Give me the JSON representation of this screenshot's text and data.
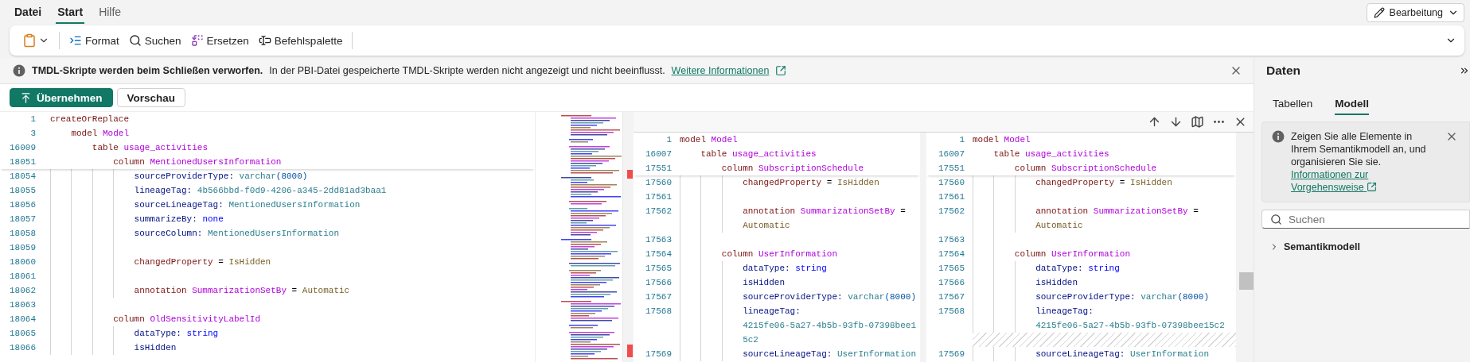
{
  "menu": {
    "tabs": [
      {
        "label": "Datei",
        "kind": "menu",
        "selected": false
      },
      {
        "label": "Start",
        "kind": "tab",
        "selected": true
      },
      {
        "label": "Hilfe",
        "kind": "tab",
        "selected": false
      }
    ],
    "mode_button": "Bearbeitung"
  },
  "toolbar": {
    "items": [
      {
        "kind": "paste"
      },
      {
        "kind": "format",
        "label": "Format"
      },
      {
        "kind": "search",
        "label": "Suchen"
      },
      {
        "kind": "replace",
        "label": "Ersetzen"
      },
      {
        "kind": "palette",
        "label": "Befehlspalette"
      }
    ]
  },
  "infobar": {
    "title": "TMDL-Skripte werden beim Schließen verworfen.",
    "message": "In der PBI-Datei gespeicherte TMDL-Skripte werden nicht angezeigt und nicht beeinflusst.",
    "link": "Weitere Informationen"
  },
  "actions": [
    {
      "label": "Übernehmen",
      "kind": "primary"
    },
    {
      "label": "Vorschau",
      "kind": "secondary"
    }
  ],
  "editor": {
    "lines": [
      {
        "number": "1",
        "sticky": true,
        "tokens": [
          {
            "kind": "keyword",
            "text": "createOrReplace"
          }
        ],
        "children": [
          {
            "number": "3",
            "sticky": true,
            "tokens": [
              {
                "kind": "keyword",
                "text": "model"
              },
              {
                "kind": "name",
                "text": "Model"
              }
            ],
            "children": [
              {
                "number": "16009",
                "sticky": true,
                "tokens": [
                  {
                    "kind": "keyword",
                    "text": "table"
                  },
                  {
                    "kind": "name",
                    "text": "usage_activities"
                  }
                ],
                "children": [
                  {
                    "number": "18051",
                    "sticky": true,
                    "tokens": [
                      {
                        "kind": "keyword",
                        "text": "column"
                      },
                      {
                        "kind": "name",
                        "text": "MentionedUsersInformation"
                      }
                    ],
                    "children": [
                      {
                        "number": "18054",
                        "tokens": [
                          {
                            "kind": "property",
                            "text": "sourceProviderType:"
                          },
                          {
                            "kind": "value",
                            "text": "varchar"
                          },
                          {
                            "kind": "bracket",
                            "text": "(8000)",
                            "attached": true
                          }
                        ]
                      },
                      {
                        "number": "18055",
                        "tokens": [
                          {
                            "kind": "property",
                            "text": "lineageTag:"
                          },
                          {
                            "kind": "value",
                            "text": "4b566bbd-f0d9-4206-a345-2dd81ad3baa1"
                          }
                        ]
                      },
                      {
                        "number": "18056",
                        "tokens": [
                          {
                            "kind": "property",
                            "text": "sourceLineageTag:"
                          },
                          {
                            "kind": "value",
                            "text": "MentionedUsersInformation"
                          }
                        ]
                      },
                      {
                        "number": "18057",
                        "tokens": [
                          {
                            "kind": "property",
                            "text": "summarizeBy:"
                          },
                          {
                            "kind": "enum",
                            "text": "none"
                          }
                        ]
                      },
                      {
                        "number": "18058",
                        "tokens": [
                          {
                            "kind": "property",
                            "text": "sourceColumn:"
                          },
                          {
                            "kind": "value",
                            "text": "MentionedUsersInformation"
                          }
                        ]
                      },
                      {
                        "number": "18059"
                      },
                      {
                        "number": "18060",
                        "tokens": [
                          {
                            "kind": "keyword",
                            "text": "changedProperty"
                          },
                          {
                            "kind": "operator",
                            "text": "="
                          },
                          {
                            "kind": "literal",
                            "text": "IsHidden"
                          }
                        ]
                      },
                      {
                        "number": "18061"
                      },
                      {
                        "number": "18062",
                        "tokens": [
                          {
                            "kind": "keyword",
                            "text": "annotation"
                          },
                          {
                            "kind": "name",
                            "text": "SummarizationSetBy"
                          },
                          {
                            "kind": "operator",
                            "text": "="
                          },
                          {
                            "kind": "literal",
                            "text": "Automatic"
                          }
                        ]
                      }
                    ]
                  },
                  {
                    "number": "18063"
                  },
                  {
                    "number": "18064",
                    "tokens": [
                      {
                        "kind": "keyword",
                        "text": "column"
                      },
                      {
                        "kind": "name",
                        "text": "OldSensitivityLabelId"
                      }
                    ],
                    "children": [
                      {
                        "number": "18065",
                        "tokens": [
                          {
                            "kind": "property",
                            "text": "dataType:"
                          },
                          {
                            "kind": "enum",
                            "text": "string"
                          }
                        ]
                      },
                      {
                        "number": "18066",
                        "tokens": [
                          {
                            "kind": "property",
                            "text": "isHidden"
                          }
                        ]
                      }
                    ]
                  }
                ]
              }
            ]
          }
        ]
      }
    ]
  },
  "diff": {
    "panes": [
      {
        "lines": [
          {
            "number": "1",
            "sticky": true,
            "tokens": [
              {
                "kind": "keyword",
                "text": "model"
              },
              {
                "kind": "name",
                "text": "Model"
              }
            ],
            "children": [
              {
                "number": "16007",
                "sticky": true,
                "tokens": [
                  {
                    "kind": "keyword",
                    "text": "table"
                  },
                  {
                    "kind": "name",
                    "text": "usage_activities"
                  }
                ],
                "children": [
                  {
                    "number": "17551",
                    "sticky": true,
                    "tokens": [
                      {
                        "kind": "keyword",
                        "text": "column"
                      },
                      {
                        "kind": "name",
                        "text": "SubscriptionSchedule"
                      }
                    ],
                    "children": [
                      {
                        "number": "17560",
                        "tokens": [
                          {
                            "kind": "keyword",
                            "text": "changedProperty"
                          },
                          {
                            "kind": "operator",
                            "text": "="
                          },
                          {
                            "kind": "literal",
                            "text": "IsHidden"
                          }
                        ]
                      },
                      {
                        "number": "17561"
                      },
                      {
                        "number": "17562",
                        "tokens": [
                          {
                            "kind": "keyword",
                            "text": "annotation"
                          },
                          {
                            "kind": "name",
                            "text": "SummarizationSetBy"
                          },
                          {
                            "kind": "operator",
                            "text": "="
                          }
                        ],
                        "continued": [
                          {
                            "tokens": [
                              {
                                "kind": "literal",
                                "text": "Automatic"
                              }
                            ]
                          }
                        ]
                      }
                    ]
                  },
                  {
                    "number": "17563"
                  },
                  {
                    "number": "17564",
                    "tokens": [
                      {
                        "kind": "keyword",
                        "text": "column"
                      },
                      {
                        "kind": "name",
                        "text": "UserInformation"
                      }
                    ],
                    "children": [
                      {
                        "number": "17565",
                        "tokens": [
                          {
                            "kind": "property",
                            "text": "dataType:"
                          },
                          {
                            "kind": "enum",
                            "text": "string"
                          }
                        ]
                      },
                      {
                        "number": "17566",
                        "tokens": [
                          {
                            "kind": "property",
                            "text": "isHidden"
                          }
                        ]
                      },
                      {
                        "number": "17567",
                        "tokens": [
                          {
                            "kind": "property",
                            "text": "sourceProviderType:"
                          },
                          {
                            "kind": "value",
                            "text": "varchar"
                          },
                          {
                            "kind": "bracket",
                            "text": "(8000)",
                            "attached": true
                          }
                        ]
                      },
                      {
                        "number": "17568",
                        "tokens": [
                          {
                            "kind": "property",
                            "text": "lineageTag:"
                          }
                        ],
                        "continued": [
                          {
                            "tokens": [
                              {
                                "kind": "value",
                                "text": "4215fe06-5a27-4b5b-93fb-07398bee1"
                              }
                            ]
                          },
                          {
                            "tokens": [
                              {
                                "kind": "value",
                                "text": "5c2"
                              }
                            ]
                          }
                        ]
                      },
                      {
                        "number": "17569",
                        "tokens": [
                          {
                            "kind": "property",
                            "text": "sourceLineageTag:"
                          },
                          {
                            "kind": "value",
                            "text": "UserInformation"
                          }
                        ]
                      }
                    ]
                  }
                ]
              }
            ]
          }
        ]
      },
      {
        "lines": [
          {
            "number": "1",
            "sticky": true,
            "tokens": [
              {
                "kind": "keyword",
                "text": "model"
              },
              {
                "kind": "name",
                "text": "Model"
              }
            ],
            "children": [
              {
                "number": "16007",
                "sticky": true,
                "tokens": [
                  {
                    "kind": "keyword",
                    "text": "table"
                  },
                  {
                    "kind": "name",
                    "text": "usage_activities"
                  }
                ],
                "children": [
                  {
                    "number": "17551",
                    "sticky": true,
                    "tokens": [
                      {
                        "kind": "keyword",
                        "text": "column"
                      },
                      {
                        "kind": "name",
                        "text": "SubscriptionSchedule"
                      }
                    ],
                    "children": [
                      {
                        "number": "17560",
                        "tokens": [
                          {
                            "kind": "keyword",
                            "text": "changedProperty"
                          },
                          {
                            "kind": "operator",
                            "text": "="
                          },
                          {
                            "kind": "literal",
                            "text": "IsHidden"
                          }
                        ]
                      },
                      {
                        "number": "17561"
                      },
                      {
                        "number": "17562",
                        "tokens": [
                          {
                            "kind": "keyword",
                            "text": "annotation"
                          },
                          {
                            "kind": "name",
                            "text": "SummarizationSetBy"
                          },
                          {
                            "kind": "operator",
                            "text": "="
                          }
                        ],
                        "continued": [
                          {
                            "tokens": [
                              {
                                "kind": "literal",
                                "text": "Automatic"
                              }
                            ]
                          }
                        ]
                      }
                    ]
                  },
                  {
                    "number": "17563"
                  },
                  {
                    "number": "17564",
                    "tokens": [
                      {
                        "kind": "keyword",
                        "text": "column"
                      },
                      {
                        "kind": "name",
                        "text": "UserInformation"
                      }
                    ],
                    "children": [
                      {
                        "kind": "line",
                        "number": "17565",
                        "tokens": [
                          {
                            "kind": "property",
                            "text": "dataType:"
                          },
                          {
                            "kind": "enum",
                            "text": "string"
                          }
                        ]
                      },
                      {
                        "kind": "line",
                        "number": "17566",
                        "tokens": [
                          {
                            "kind": "property",
                            "text": "isHidden"
                          }
                        ]
                      },
                      {
                        "kind": "line",
                        "number": "17567",
                        "tokens": [
                          {
                            "kind": "property",
                            "text": "sourceProviderType:"
                          },
                          {
                            "kind": "value",
                            "text": "varchar"
                          },
                          {
                            "kind": "bracket",
                            "text": "(8000)",
                            "attached": true
                          }
                        ]
                      },
                      {
                        "kind": "line",
                        "number": "17568",
                        "tokens": [
                          {
                            "kind": "property",
                            "text": "lineageTag:"
                          }
                        ],
                        "continued": [
                          {
                            "tokens": [
                              {
                                "kind": "value",
                                "text": "4215fe06-5a27-4b5b-93fb-07398bee15c2"
                              }
                            ]
                          }
                        ]
                      },
                      {
                        "kind": "spacer"
                      },
                      {
                        "kind": "line",
                        "number": "17569",
                        "tokens": [
                          {
                            "kind": "property",
                            "text": "sourceLineageTag:"
                          },
                          {
                            "kind": "value",
                            "text": "UserInformation"
                          }
                        ]
                      }
                    ]
                  }
                ]
              }
            ]
          }
        ]
      }
    ]
  },
  "data_panel": {
    "title": "Daten",
    "tabs": [
      {
        "label": "Tabellen",
        "selected": false
      },
      {
        "label": "Modell",
        "selected": true
      }
    ],
    "notice": {
      "text": "Zeigen Sie alle Elemente in Ihrem Semantikmodell an, und organisieren Sie sie.",
      "link": "Informationen zur Vorgehensweise"
    },
    "search": {
      "placeholder": "Suchen"
    },
    "tree": [
      {
        "label": "Semantikmodell",
        "expanded": false
      }
    ]
  }
}
